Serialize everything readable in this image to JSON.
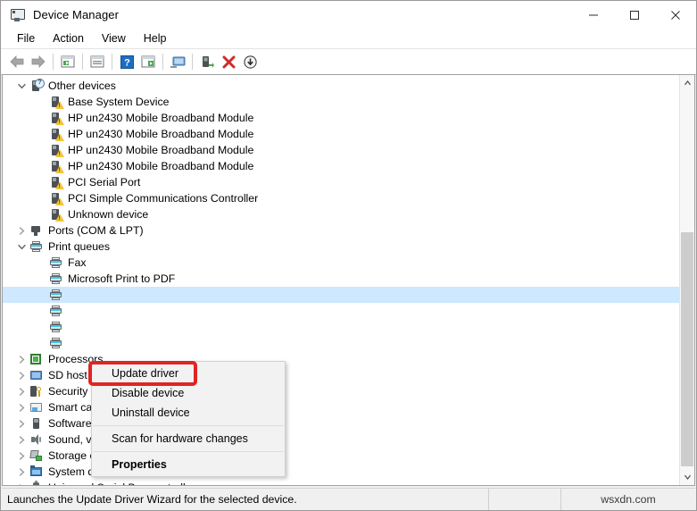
{
  "window": {
    "title": "Device Manager",
    "icon": "device-manager-icon",
    "controls": {
      "minimize": "minimize",
      "maximize": "maximize",
      "close": "close"
    }
  },
  "menubar": {
    "items": [
      "File",
      "Action",
      "View",
      "Help"
    ]
  },
  "toolbar": {
    "buttons": [
      "back-icon",
      "forward-icon",
      "separator",
      "show-properties-icon",
      "separator",
      "update-driver-icon",
      "separator",
      "help-icon",
      "scan-icon",
      "separator",
      "display-icon",
      "separator",
      "install-legacy-icon",
      "uninstall-device-icon",
      "disable-device-icon"
    ]
  },
  "tree": {
    "rows": [
      {
        "label": "Other devices",
        "indent": 0,
        "chevron": "down",
        "icon": "device-question",
        "selected": false
      },
      {
        "label": "Base System Device",
        "indent": 1,
        "chevron": "none",
        "icon": "device-warning",
        "selected": false
      },
      {
        "label": "HP un2430 Mobile Broadband Module",
        "indent": 1,
        "chevron": "none",
        "icon": "device-warning",
        "selected": false
      },
      {
        "label": "HP un2430 Mobile Broadband Module",
        "indent": 1,
        "chevron": "none",
        "icon": "device-warning",
        "selected": false
      },
      {
        "label": "HP un2430 Mobile Broadband Module",
        "indent": 1,
        "chevron": "none",
        "icon": "device-warning",
        "selected": false
      },
      {
        "label": "HP un2430 Mobile Broadband Module",
        "indent": 1,
        "chevron": "none",
        "icon": "device-warning",
        "selected": false
      },
      {
        "label": "PCI Serial Port",
        "indent": 1,
        "chevron": "none",
        "icon": "device-warning",
        "selected": false
      },
      {
        "label": "PCI Simple Communications Controller",
        "indent": 1,
        "chevron": "none",
        "icon": "device-warning",
        "selected": false
      },
      {
        "label": "Unknown device",
        "indent": 1,
        "chevron": "none",
        "icon": "device-warning",
        "selected": false
      },
      {
        "label": "Ports (COM & LPT)",
        "indent": 0,
        "chevron": "right",
        "icon": "port",
        "selected": false
      },
      {
        "label": "Print queues",
        "indent": 0,
        "chevron": "down",
        "icon": "printer",
        "selected": false
      },
      {
        "label": "Fax",
        "indent": 1,
        "chevron": "none",
        "icon": "printer",
        "selected": false
      },
      {
        "label": "Microsoft Print to PDF",
        "indent": 1,
        "chevron": "none",
        "icon": "printer",
        "selected": false
      },
      {
        "label": "",
        "indent": 1,
        "chevron": "none",
        "icon": "printer",
        "selected": true
      },
      {
        "label": "",
        "indent": 1,
        "chevron": "none",
        "icon": "printer",
        "selected": false
      },
      {
        "label": "",
        "indent": 1,
        "chevron": "none",
        "icon": "printer",
        "selected": false
      },
      {
        "label": "",
        "indent": 1,
        "chevron": "none",
        "icon": "printer",
        "selected": false
      },
      {
        "label": "Processors",
        "indent": 0,
        "chevron": "right",
        "icon": "processor",
        "selected": false
      },
      {
        "label": "SD host adapters",
        "indent": 0,
        "chevron": "right",
        "icon": "sd-adapter",
        "selected": false
      },
      {
        "label": "Security devices",
        "indent": 0,
        "chevron": "right",
        "icon": "security-key",
        "selected": false
      },
      {
        "label": "Smart card readers",
        "indent": 0,
        "chevron": "right",
        "icon": "smart-card",
        "selected": false
      },
      {
        "label": "Software devices",
        "indent": 0,
        "chevron": "right",
        "icon": "software-device",
        "selected": false
      },
      {
        "label": "Sound, video and game controllers",
        "indent": 0,
        "chevron": "right",
        "icon": "sound",
        "selected": false
      },
      {
        "label": "Storage controllers",
        "indent": 0,
        "chevron": "right",
        "icon": "storage",
        "selected": false
      },
      {
        "label": "System devices",
        "indent": 0,
        "chevron": "right",
        "icon": "system-device",
        "selected": false
      },
      {
        "label": "Universal Serial Bus controllers",
        "indent": 0,
        "chevron": "right",
        "icon": "usb",
        "selected": false
      }
    ]
  },
  "context_menu": {
    "items": [
      {
        "label": "Update driver",
        "bold": false,
        "highlighted": true
      },
      {
        "label": "Disable device",
        "bold": false,
        "highlighted": false
      },
      {
        "label": "Uninstall device",
        "bold": false,
        "highlighted": false
      },
      {
        "separator": true
      },
      {
        "label": "Scan for hardware changes",
        "bold": false,
        "highlighted": false
      },
      {
        "separator": true
      },
      {
        "label": "Properties",
        "bold": true,
        "highlighted": false
      }
    ],
    "highlight_color": "#e02424"
  },
  "statusbar": {
    "message": "Launches the Update Driver Wizard for the selected device.",
    "watermark": "wsxdn.com"
  }
}
